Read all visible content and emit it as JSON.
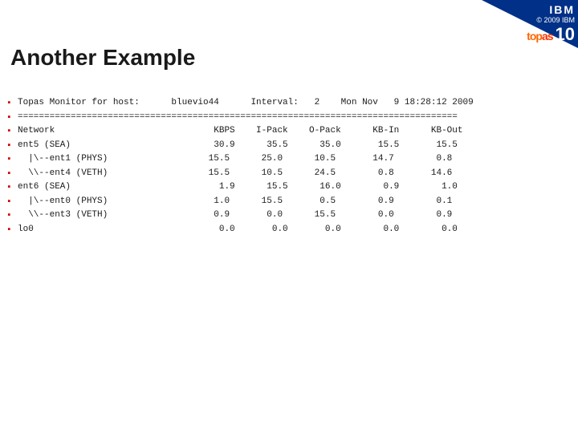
{
  "header": {
    "ibm_logo": "IBM",
    "copyright": "© 2009 IBM",
    "badge": "top",
    "badge2": "as",
    "slide_number": "10"
  },
  "title": "Another Example",
  "lines": [
    {
      "bullet": true,
      "text": "Topas Monitor for host:      bluevio44      Interval:   2    Mon Nov   9 18:28:12 2009",
      "bold": false
    },
    {
      "bullet": true,
      "text": "===================================================================================",
      "bold": false
    },
    {
      "bullet": true,
      "text": "Network                              KBPS    I-Pack    O-Pack      KB-In      KB-Out",
      "bold": false
    },
    {
      "bullet": true,
      "text": "ent5 (SEA)                           30.9      35.5      35.0       15.5       15.5",
      "bold": false
    },
    {
      "bullet": true,
      "text": "  |\\--ent1 (PHYS)                   15.5      25.0      10.5       14.7        0.8",
      "bold": false
    },
    {
      "bullet": true,
      "text": "  \\\\--ent4 (VETH)                   15.5      10.5      24.5        0.8       14.6",
      "bold": false
    },
    {
      "bullet": true,
      "text": "ent6 (SEA)                            1.9      15.5      16.0        0.9        1.0",
      "bold": false
    },
    {
      "bullet": true,
      "text": "  |\\--ent0 (PHYS)                    1.0      15.5       0.5        0.9        0.1",
      "bold": false
    },
    {
      "bullet": true,
      "text": "  \\\\--ent3 (VETH)                    0.9       0.0      15.5        0.0        0.9",
      "bold": false
    },
    {
      "bullet": true,
      "text": "lo0                                   0.0       0.0       0.0        0.0        0.0",
      "bold": false
    }
  ]
}
